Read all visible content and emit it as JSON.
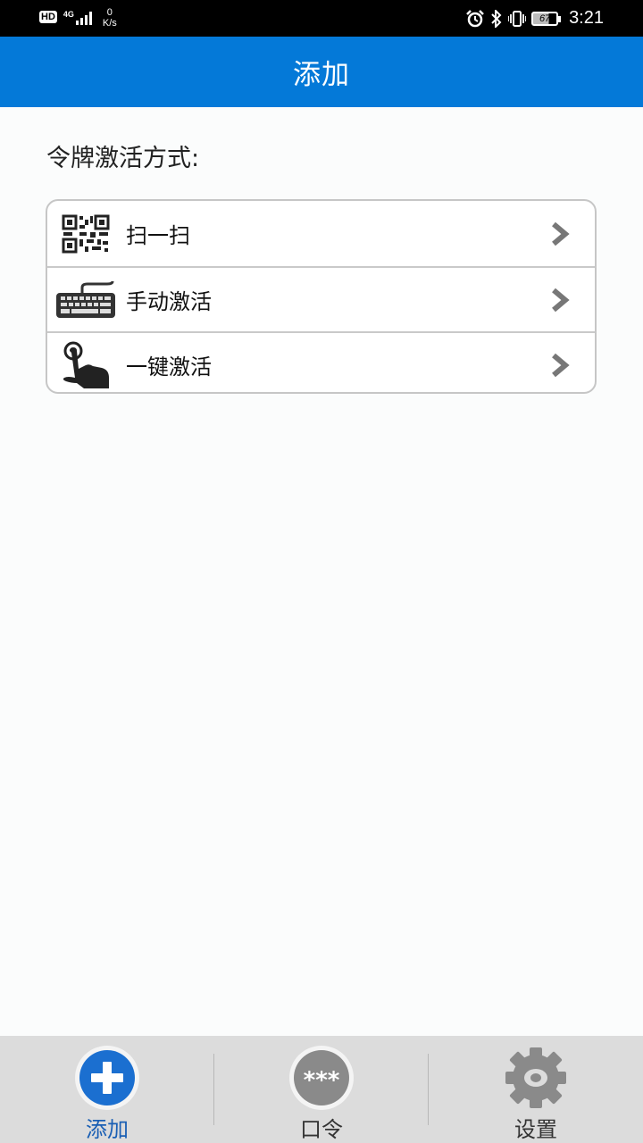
{
  "status_bar": {
    "hd": "HD",
    "network": "4G",
    "speed_value": "0",
    "speed_unit": "K/s",
    "battery": "67",
    "time": "3:21"
  },
  "header": {
    "title": "添加"
  },
  "main": {
    "section_label": "令牌激活方式:",
    "items": [
      {
        "label": "扫一扫",
        "icon": "qr-code-icon"
      },
      {
        "label": "手动激活",
        "icon": "keyboard-icon"
      },
      {
        "label": "一键激活",
        "icon": "hand-tap-icon"
      }
    ]
  },
  "tabbar": {
    "tabs": [
      {
        "label": "添加",
        "icon": "add-icon",
        "active": true
      },
      {
        "label": "口令",
        "icon": "password-icon",
        "icon_text": "***"
      },
      {
        "label": "设置",
        "icon": "gear-icon"
      }
    ]
  },
  "colors": {
    "accent": "#0479d8",
    "tab_active": "#1a5fb4"
  }
}
